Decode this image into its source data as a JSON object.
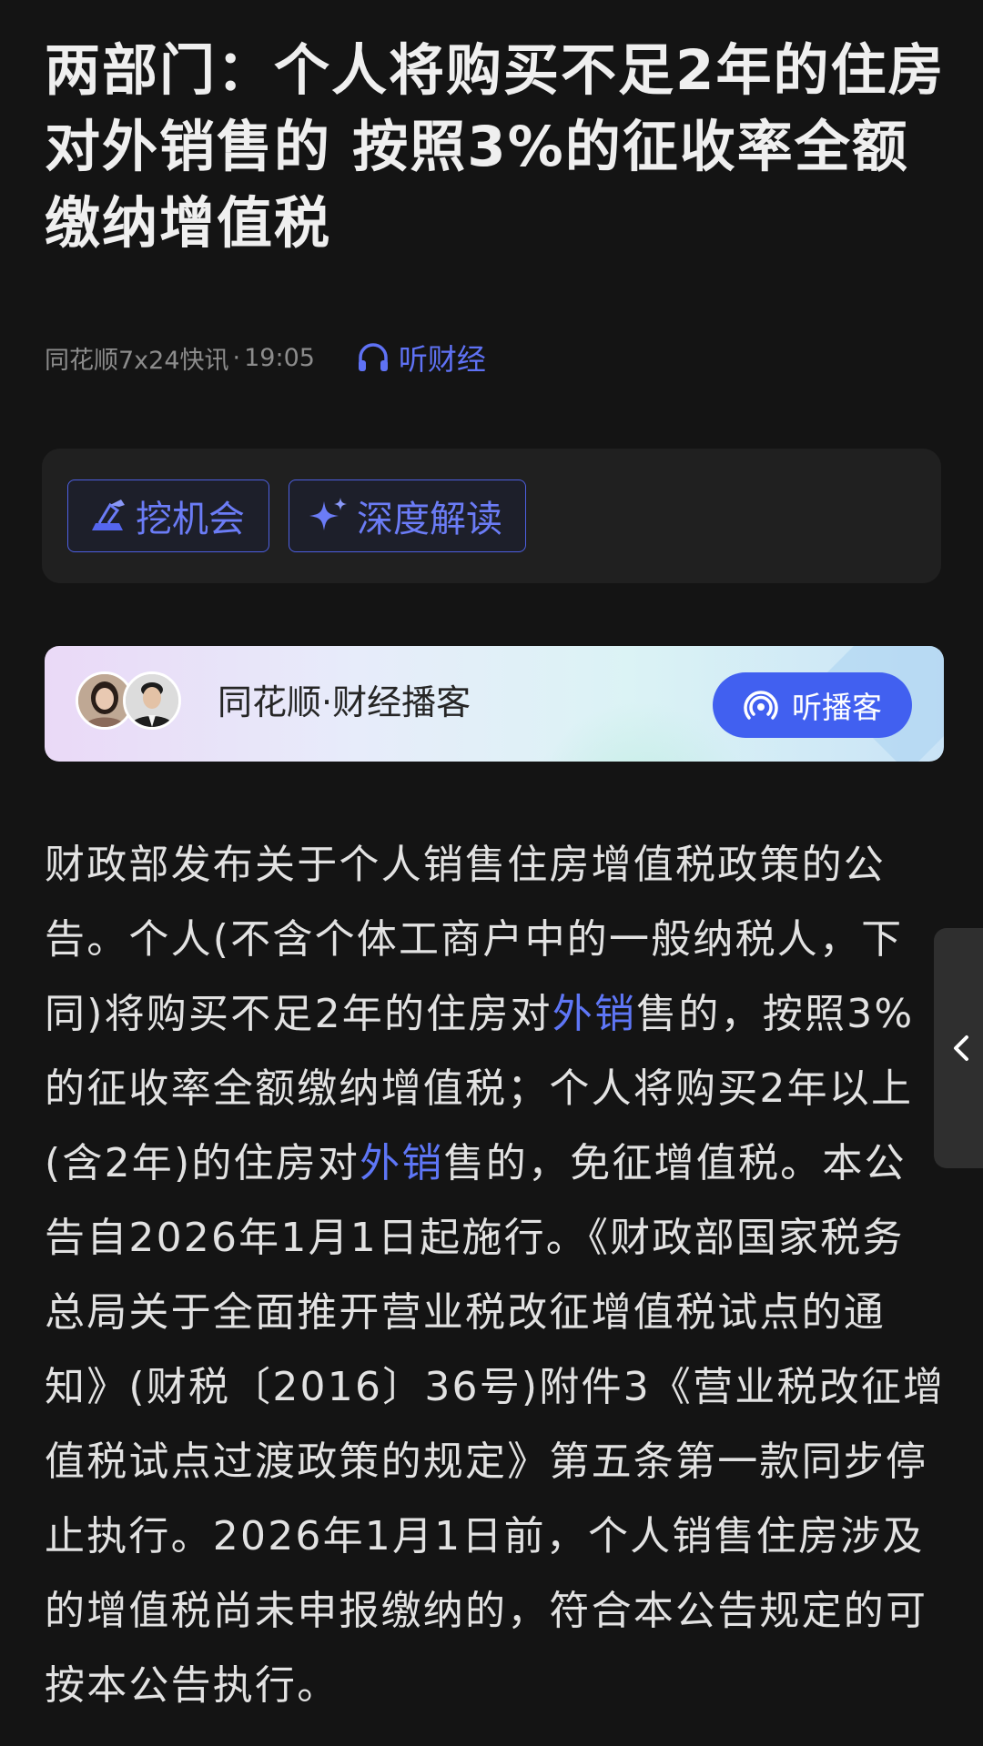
{
  "article": {
    "title": "两部门：个人将购买不足2年的住房对外销售的 按照3%的征收率全额缴纳增值税",
    "source": "同花顺7x24快讯",
    "dot": "·",
    "time": "19:05",
    "listen_label": "听财经"
  },
  "ai_tools": {
    "opportunity_label": "挖机会",
    "deep_read_label": "深度解读"
  },
  "podcast": {
    "title": "同花顺·财经播客",
    "button_label": "听播客"
  },
  "body": {
    "seg1": "财政部发布关于个人销售住房增值税政策的公告。个人(不含个体工商户中的一般纳税人，下同)将购买不足2年的住房对",
    "link1": "外销",
    "seg2": "售的，按照3%的征收率全额缴纳增值税；个人将购买2年以上(含2年)的住房对",
    "link2": "外销",
    "seg3": "售的，免征增值税。本公告自2026年1月1日起施行。《财政部国家税务总局关于全面推开营业税改征增值税试点的通知》(财税〔2016〕36号)附件3《营业税改征增值税试点过渡政策的规定》第五条第一款同步停止执行。2026年1月1日前，个人销售住房涉及的增值税尚未申报缴纳的，符合本公告规定的可按本公告执行。"
  },
  "colors": {
    "background": "#141414",
    "accent": "#5e76f6",
    "podcast_button": "#4160f0"
  },
  "icons": {
    "listen": "headphones-icon",
    "opportunity": "excavator-icon",
    "deep_read": "sparkle-icon",
    "podcast": "broadcast-icon",
    "side_tab": "chevron-left-icon"
  }
}
